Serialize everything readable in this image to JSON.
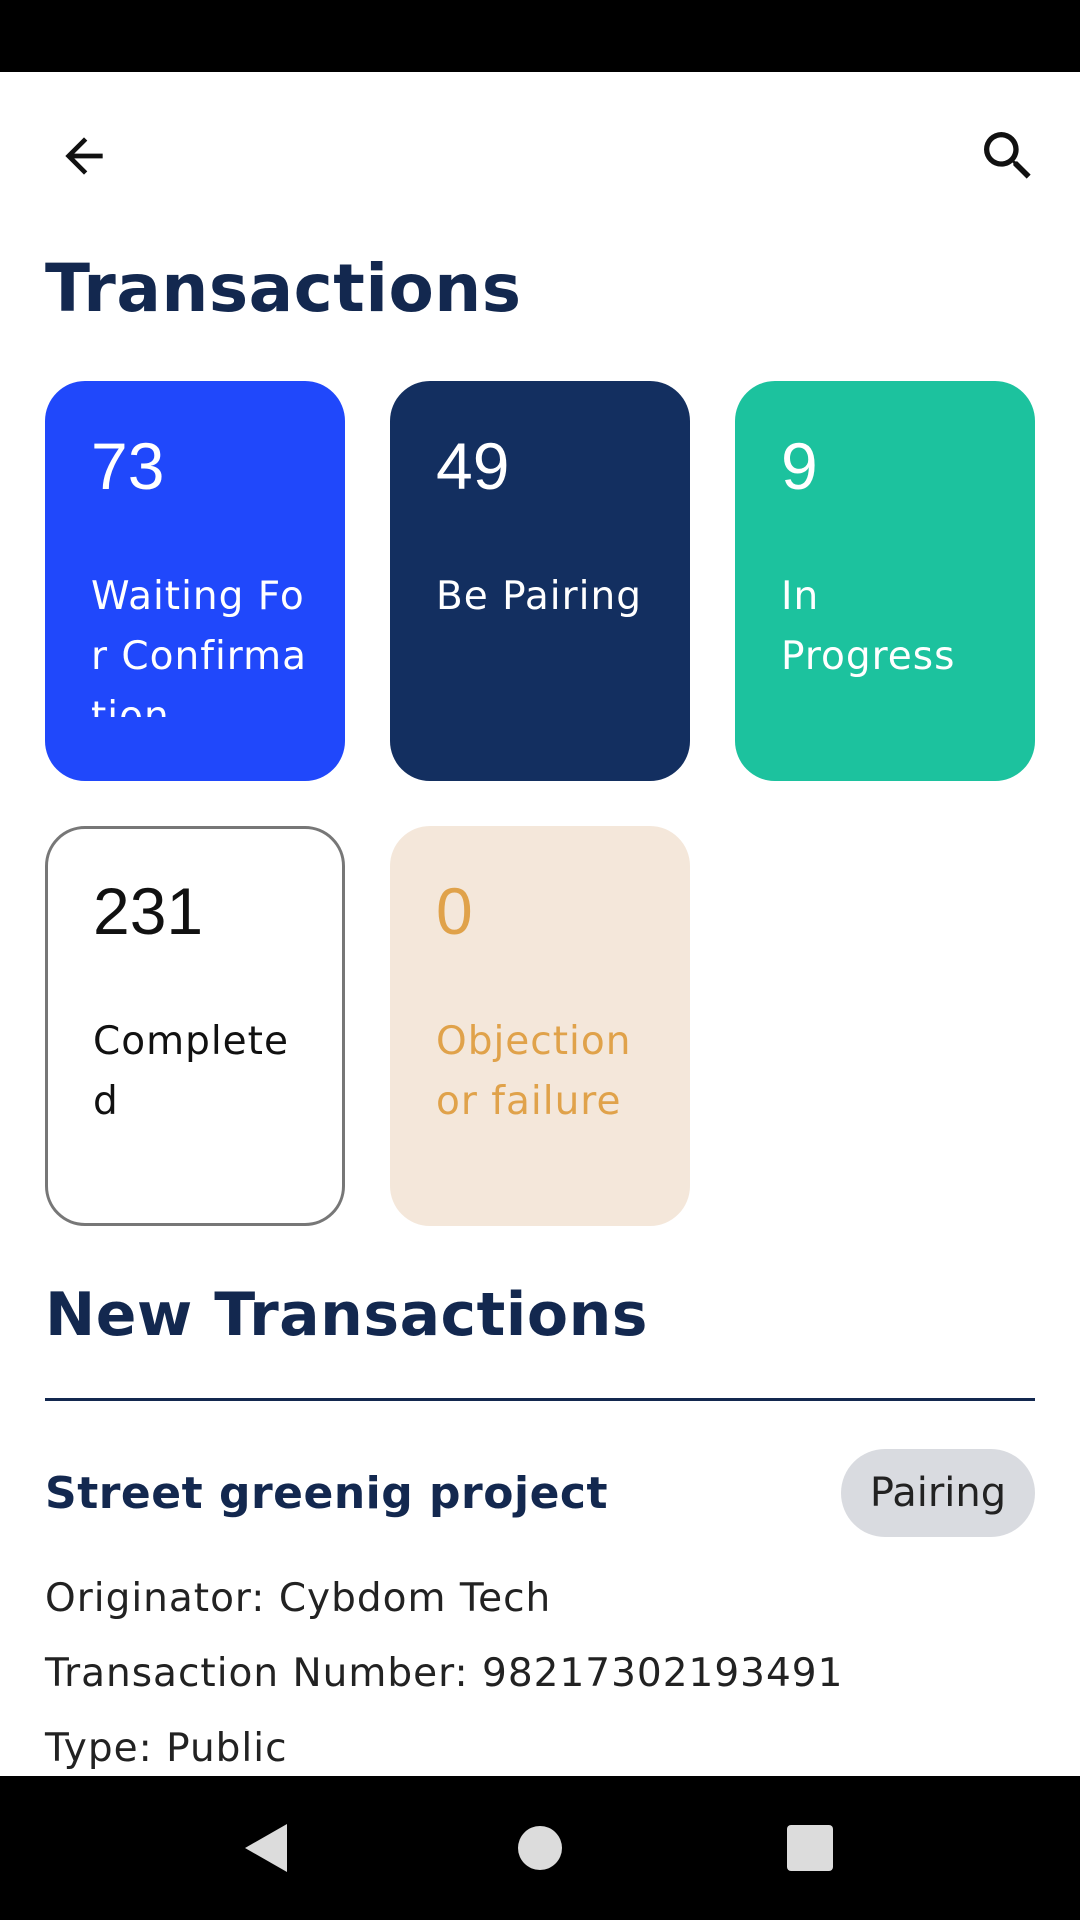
{
  "header": {
    "title": "Transactions"
  },
  "stats": [
    {
      "count": "73",
      "label": "Waiting For Confirmation",
      "color": "#2048fb"
    },
    {
      "count": "49",
      "label": "Be Pairing",
      "color": "#132f60"
    },
    {
      "count": "9",
      "label": "In Progress",
      "color": "#1cc29e"
    },
    {
      "count": "231",
      "label": "Completed",
      "color": "#ffffff"
    },
    {
      "count": "0",
      "label": "Objection or failure",
      "color": "#f4e7da"
    }
  ],
  "new_transactions": {
    "title": "New Transactions",
    "items": [
      {
        "name": "Street greenig project",
        "status": "Pairing",
        "originator": "Originator: Cybdom Tech",
        "number": "Transaction Number: 98217302193491",
        "type": "Type: Public"
      }
    ]
  },
  "icons": {
    "back": "arrow-left-icon",
    "search": "search-icon",
    "nav_back": "triangle-back-icon",
    "nav_home": "circle-home-icon",
    "nav_recent": "square-recent-icon"
  }
}
